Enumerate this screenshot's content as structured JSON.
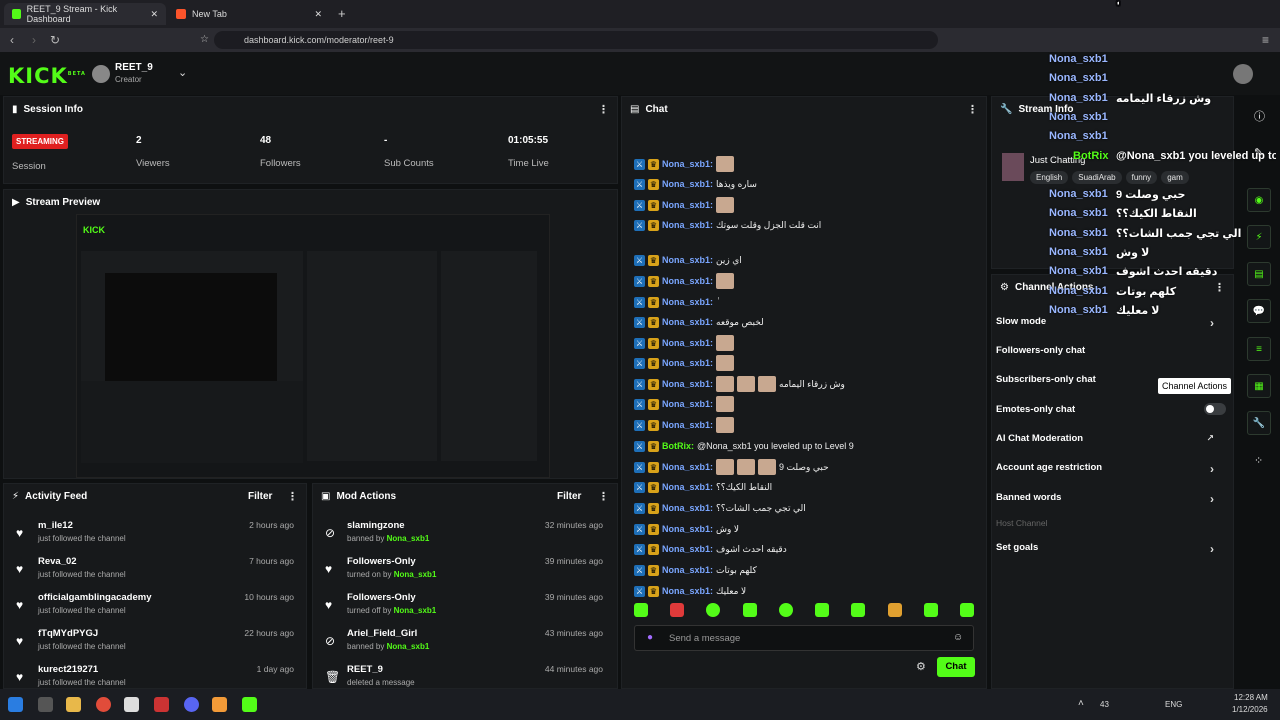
{
  "browser": {
    "tab1": "REET_9 Stream - Kick Dashboard",
    "tab2": "New Tab",
    "url": "dashboard.kick.com/moderator/reet-9"
  },
  "header": {
    "logo": "KICK",
    "beta": "BETA",
    "user": "REET_9",
    "role": "Creator"
  },
  "session": {
    "title": "Session Info",
    "status": "STREAMING",
    "session_label": "Session",
    "stats": [
      {
        "v": "2",
        "l": "Viewers"
      },
      {
        "v": "48",
        "l": "Followers"
      },
      {
        "v": "-",
        "l": "Sub Counts"
      },
      {
        "v": "01:05:55",
        "l": "Time Live"
      }
    ]
  },
  "preview": {
    "title": "Stream Preview"
  },
  "activity": {
    "title": "Activity Feed",
    "filter": "Filter",
    "rows": [
      {
        "n": "m_ile12",
        "s": "just followed the channel",
        "t": "2 hours ago"
      },
      {
        "n": "Reva_02",
        "s": "just followed the channel",
        "t": "7 hours ago"
      },
      {
        "n": "officialgamblingacademy",
        "s": "just followed the channel",
        "t": "10 hours ago"
      },
      {
        "n": "fTqMYdPYGJ",
        "s": "just followed the channel",
        "t": "22 hours ago"
      },
      {
        "n": "kurect219271",
        "s": "just followed the channel",
        "t": "1 day ago"
      }
    ]
  },
  "mod": {
    "title": "Mod Actions",
    "filter": "Filter",
    "rows": [
      {
        "n": "slamingzone",
        "pre": "banned by ",
        "by": "Nona_sxb1",
        "t": "32 minutes ago"
      },
      {
        "n": "Followers-Only",
        "pre": "turned on by ",
        "by": "Nona_sxb1",
        "t": "39 minutes ago"
      },
      {
        "n": "Followers-Only",
        "pre": "turned off by ",
        "by": "Nona_sxb1",
        "t": "39 minutes ago"
      },
      {
        "n": "Ariel_Field_Girl",
        "pre": "banned by ",
        "by": "Nona_sxb1",
        "t": "43 minutes ago"
      },
      {
        "n": "REET_9",
        "pre": "deleted a message",
        "by": "",
        "t": "44 minutes ago"
      }
    ]
  },
  "chat": {
    "title": "Chat",
    "placeholder": "Send a message",
    "send": "Chat",
    "lines": [
      {
        "u": "Nona_sxb1:",
        "m": ""
      },
      {
        "u": "Nona_sxb1:",
        "m": "ساره ويذها"
      },
      {
        "u": "Nona_sxb1:",
        "m": ""
      },
      {
        "u": "Nona_sxb1:",
        "m": "انت قلت الجزل وقلت سوتك"
      },
      {
        "u": "Nona_sxb1:",
        "m": "اي زين"
      },
      {
        "u": "Nona_sxb1:",
        "m": ""
      },
      {
        "u": "Nona_sxb1:",
        "m": "ٰٰٰٰٰٰٰٰٰٰٰٰٰٰٰٰٰٰٰٰ"
      },
      {
        "u": "Nona_sxb1:",
        "m": "لخبص موقعه"
      },
      {
        "u": "Nona_sxb1:",
        "m": ""
      },
      {
        "u": "Nona_sxb1:",
        "m": ""
      },
      {
        "u": "Nona_sxb1:",
        "m": "وش زرقاء اليمامه"
      },
      {
        "u": "Nona_sxb1:",
        "m": ""
      },
      {
        "u": "Nona_sxb1:",
        "m": ""
      },
      {
        "u": "BotRix:",
        "m": "@Nona_sxb1 you leveled up to Level 9"
      },
      {
        "u": "Nona_sxb1:",
        "m": "حبي وصلت 9"
      },
      {
        "u": "Nona_sxb1:",
        "m": "النقاط الكيك؟؟"
      },
      {
        "u": "Nona_sxb1:",
        "m": "الي تجي جمب الشات؟؟"
      },
      {
        "u": "Nona_sxb1:",
        "m": "لا وش"
      },
      {
        "u": "Nona_sxb1:",
        "m": "دقيقه احدث اشوف"
      },
      {
        "u": "Nona_sxb1:",
        "m": "كلهم بوتات"
      },
      {
        "u": "Nona_sxb1:",
        "m": "لا معليك"
      }
    ]
  },
  "streaminfo": {
    "title": "Stream Info",
    "tagline": "Just Chatting",
    "tags": [
      "English",
      "SuadiArab",
      "funny",
      "gam"
    ]
  },
  "actions": {
    "title": "Channel Actions",
    "tooltip": "Channel Actions",
    "rows": [
      "Slow mode",
      "Followers-only chat",
      "Subscribers-only chat",
      "Emotes-only chat",
      "AI Chat Moderation",
      "Account age restriction",
      "Banned words",
      "Host Channel",
      "Set goals"
    ]
  },
  "overlay": {
    "names": [
      "Nona_sxb1",
      "Nona_sxb1",
      "Nona_sxb1",
      "Nona_sxb1",
      "Nona_sxb1",
      "BotRix",
      "Nona_sxb1",
      "Nona_sxb1",
      "Nona_sxb1",
      "Nona_sxb1",
      "Nona_sxb1",
      "Nona_sxb1",
      "Nona_sxb1"
    ],
    "msgs": [
      "",
      "",
      "وش زرقاء اليمامه",
      "",
      "",
      "@Nona_sxb1 you leveled up to Level 9",
      "حبي وصلت 9",
      "النقاط الكيك؟؟",
      "الي تجي جمب الشات؟؟",
      "لا وش",
      "دقيقه احدث اشوف",
      "كلهم بوتات",
      "لا معليك"
    ]
  },
  "taskbar": {
    "temp": "43",
    "lang": "ENG",
    "time": "12:28 AM",
    "date": "1/12/2026"
  },
  "colors": {
    "accent": "#53fc18",
    "streaming": "#e02020"
  }
}
